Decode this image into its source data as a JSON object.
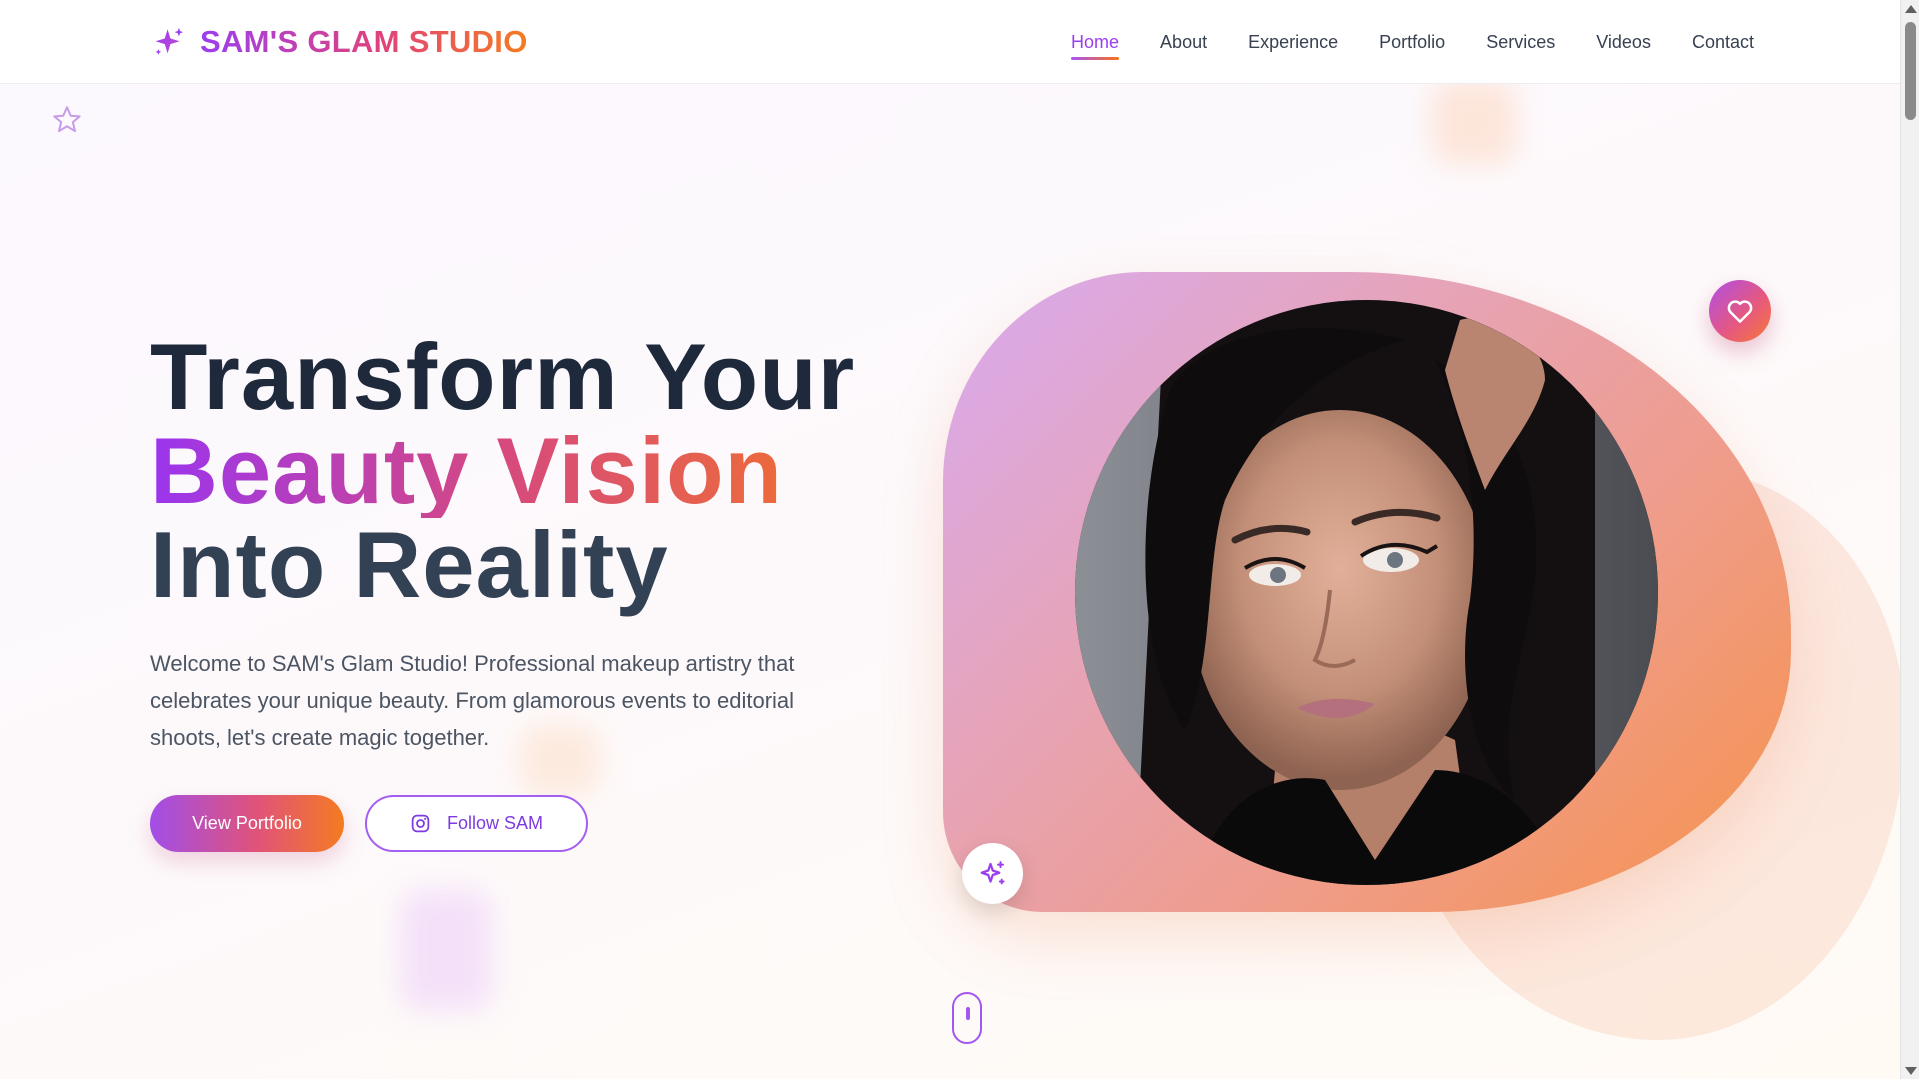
{
  "header": {
    "brand": "SAM'S GLAM STUDIO",
    "brand_icon": "sparkles-icon",
    "nav": [
      {
        "label": "Home",
        "active": true
      },
      {
        "label": "About"
      },
      {
        "label": "Experience"
      },
      {
        "label": "Portfolio"
      },
      {
        "label": "Services"
      },
      {
        "label": "Videos"
      },
      {
        "label": "Contact"
      }
    ]
  },
  "hero": {
    "title_line1": "Transform Your",
    "title_line2": "Beauty Vision",
    "title_line3": "Into Reality",
    "description": "Welcome to SAM's Glam Studio! Professional makeup artistry that celebrates your unique beauty. From glamorous events to editorial shoots, let's create magic together.",
    "primary_button": "View Portfolio",
    "secondary_button": "Follow SAM",
    "secondary_button_icon": "instagram-icon"
  },
  "visual": {
    "badge_top_icon": "heart-icon",
    "badge_bottom_icon": "sparkles-icon",
    "portrait": "woman-portrait"
  },
  "colors": {
    "purple": "#9b3ef0",
    "pink": "#e0427c",
    "orange": "#f57c1f",
    "heading_dark": "#1e293b"
  }
}
